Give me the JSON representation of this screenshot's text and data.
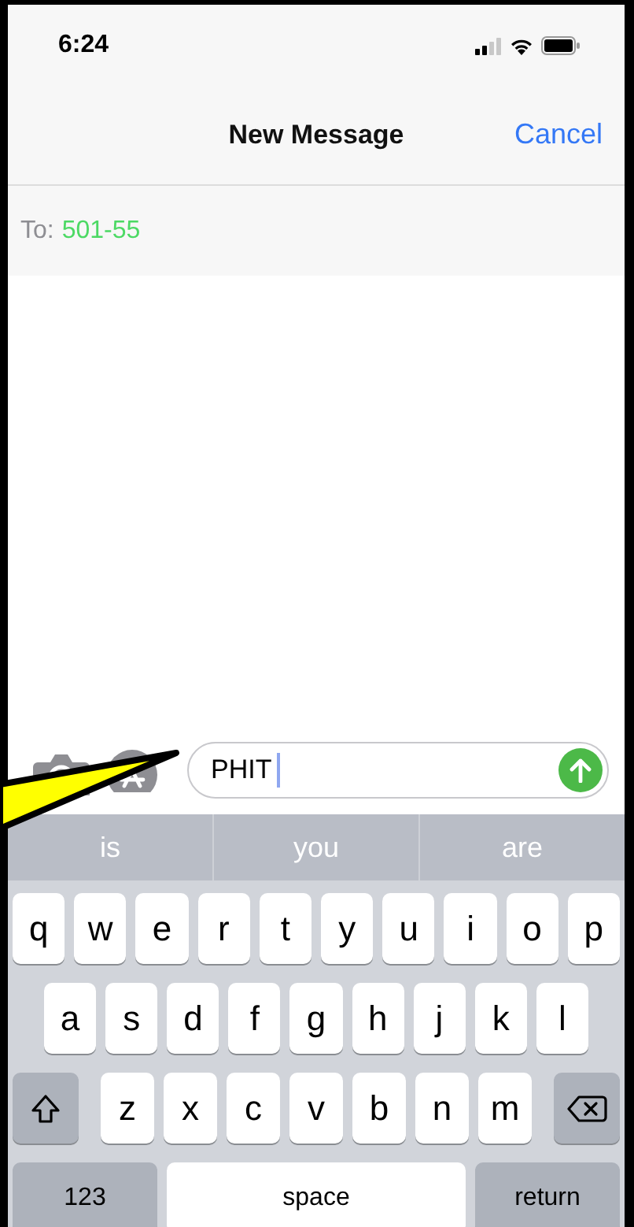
{
  "status_bar": {
    "time": "6:24"
  },
  "nav": {
    "title": "New Message",
    "action": "Cancel"
  },
  "recipient": {
    "label": "To:",
    "value": "501-55"
  },
  "compose": {
    "value": "PHIT"
  },
  "suggestions": [
    "is",
    "you",
    "are"
  ],
  "keyboard": {
    "rows": [
      [
        {
          "kind": "letter",
          "label": "q"
        },
        {
          "kind": "letter",
          "label": "w"
        },
        {
          "kind": "letter",
          "label": "e"
        },
        {
          "kind": "letter",
          "label": "r"
        },
        {
          "kind": "letter",
          "label": "t"
        },
        {
          "kind": "letter",
          "label": "y"
        },
        {
          "kind": "letter",
          "label": "u"
        },
        {
          "kind": "letter",
          "label": "i"
        },
        {
          "kind": "letter",
          "label": "o"
        },
        {
          "kind": "letter",
          "label": "p"
        }
      ],
      [
        {
          "kind": "letter",
          "label": "a"
        },
        {
          "kind": "letter",
          "label": "s"
        },
        {
          "kind": "letter",
          "label": "d"
        },
        {
          "kind": "letter",
          "label": "f"
        },
        {
          "kind": "letter",
          "label": "g"
        },
        {
          "kind": "letter",
          "label": "h"
        },
        {
          "kind": "letter",
          "label": "j"
        },
        {
          "kind": "letter",
          "label": "k"
        },
        {
          "kind": "letter",
          "label": "l"
        }
      ],
      [
        {
          "kind": "shift"
        },
        {
          "kind": "letter",
          "label": "z"
        },
        {
          "kind": "letter",
          "label": "x"
        },
        {
          "kind": "letter",
          "label": "c"
        },
        {
          "kind": "letter",
          "label": "v"
        },
        {
          "kind": "letter",
          "label": "b"
        },
        {
          "kind": "letter",
          "label": "n"
        },
        {
          "kind": "letter",
          "label": "m"
        },
        {
          "kind": "delete"
        }
      ]
    ],
    "bottom_row": [
      {
        "kind": "mode",
        "label": "123"
      },
      {
        "kind": "space",
        "label": "space"
      },
      {
        "kind": "return",
        "label": "return"
      }
    ]
  },
  "annotation": {
    "kind": "arrow"
  }
}
